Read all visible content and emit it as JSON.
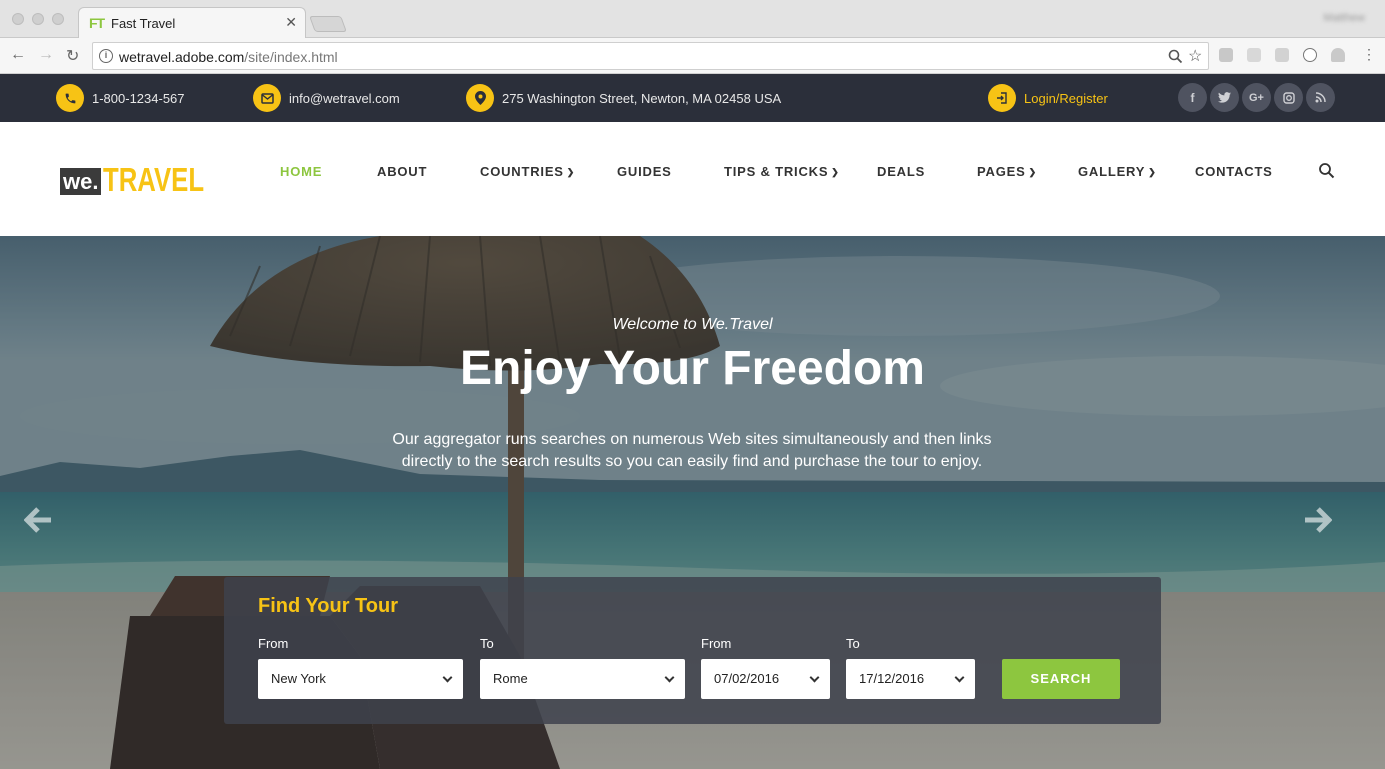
{
  "browser": {
    "tab_favicon": "FT",
    "tab_title": "Fast Travel",
    "profile": "Matthew",
    "url_host": "wetravel.adobe.com",
    "url_path": "/site/index.html"
  },
  "topbar": {
    "phone": "1-800-1234-567",
    "email": "info@wetravel.com",
    "address": "275 Washington Street, Newton, MA 02458 USA",
    "login": "Login/Register",
    "social": [
      "facebook-icon",
      "twitter-icon",
      "google-plus-icon",
      "instagram-icon",
      "rss-icon"
    ]
  },
  "header": {
    "logo_we": "we.",
    "logo_travel": "TRAVEL",
    "nav": [
      {
        "label": "HOME",
        "active": true,
        "dropdown": false
      },
      {
        "label": "ABOUT",
        "active": false,
        "dropdown": false
      },
      {
        "label": "COUNTRIES",
        "active": false,
        "dropdown": true
      },
      {
        "label": "GUIDES",
        "active": false,
        "dropdown": false
      },
      {
        "label": "TIPS & TRICKS",
        "active": false,
        "dropdown": true
      },
      {
        "label": "DEALS",
        "active": false,
        "dropdown": false
      },
      {
        "label": "PAGES",
        "active": false,
        "dropdown": true
      },
      {
        "label": "GALLERY",
        "active": false,
        "dropdown": true
      },
      {
        "label": "CONTACTS",
        "active": false,
        "dropdown": false
      }
    ]
  },
  "hero": {
    "welcome": "Welcome to We.Travel",
    "headline": "Enjoy Your Freedom",
    "lead": "Our aggregator runs searches on numerous Web sites simultaneously and then links directly to the search results so you can easily find and purchase the tour to enjoy."
  },
  "tour_search": {
    "title": "Find Your Tour",
    "from_place_label": "From",
    "from_place": "New York",
    "to_place_label": "To",
    "to_place": "Rome",
    "from_date_label": "From",
    "from_date": "07/02/2016",
    "to_date_label": "To",
    "to_date": "17/12/2016",
    "button": "SEARCH"
  },
  "colors": {
    "accent_yellow": "#f7c315",
    "accent_green": "#8dc63f",
    "topbar_bg": "#2b2f3a"
  }
}
